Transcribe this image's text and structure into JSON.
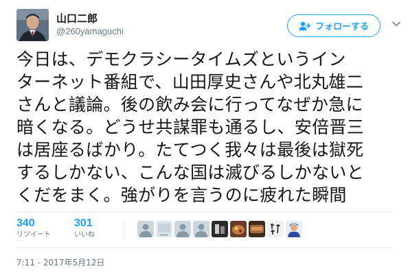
{
  "user": {
    "display_name": "山口二郎",
    "handle": "@260yamaguchi"
  },
  "follow_button": {
    "label": "フォローする",
    "icon": "add-user-icon"
  },
  "more_menu_icon": "chevron-down-icon",
  "tweet": {
    "lines": [
      "今日は、デモクラシータイムズというイン",
      "ターネット番組で、山田厚史さんや北丸雄二",
      "さんと議論。後の飲み会に行ってなぜか急に",
      "暗くなる。どうせ共謀罪も通るし、安倍晋三",
      "は居座るばかり。たてつく我々は最後は獄死",
      "するしかない、こんな国は滅びるしかないと",
      "くだをまく。強がりを言うのに疲れた瞬間"
    ]
  },
  "stats": {
    "retweets": {
      "count": "340",
      "label": "リツイート"
    },
    "likes": {
      "count": "301",
      "label": "いいね"
    }
  },
  "likers_count": 9,
  "timestamp": "7:11 - 2017年5月12日",
  "colors": {
    "accent": "#1da1f2",
    "text": "#14171a",
    "secondary": "#657786",
    "divider": "#e6ecf0"
  }
}
